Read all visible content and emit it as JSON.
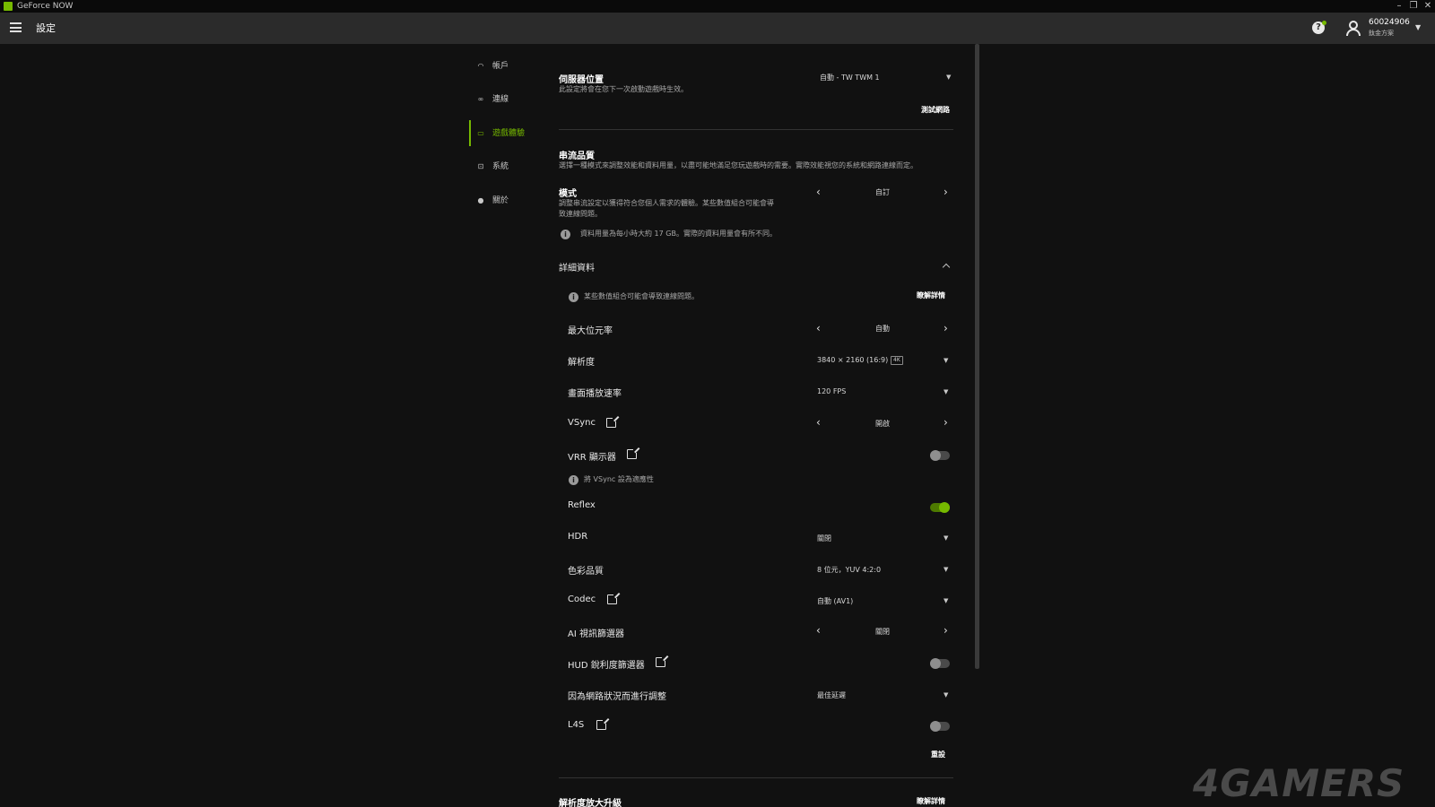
{
  "window": {
    "title": "GeForce NOW"
  },
  "header": {
    "title": "設定",
    "user_id": "60024906",
    "user_plan": "鈦金方案"
  },
  "sidebar": {
    "items": [
      {
        "label": "帳戶",
        "icon": "headset-icon"
      },
      {
        "label": "連線",
        "icon": "link-icon"
      },
      {
        "label": "遊戲體驗",
        "icon": "monitor-icon",
        "active": true
      },
      {
        "label": "系統",
        "icon": "system-icon"
      },
      {
        "label": "關於",
        "icon": "info-icon"
      }
    ]
  },
  "server": {
    "title": "伺服器位置",
    "desc": "此設定將會在您下一次啟動遊戲時生效。",
    "value": "自動 - TW TWM 1",
    "test_link": "測試網路"
  },
  "stream": {
    "title": "串流品質",
    "desc": "選擇一種模式來調整效能和資料用量，以盡可能地滿足您玩遊戲時的需要。實際效能視您的系統和網路連線而定。",
    "mode_label": "模式",
    "mode_desc_1": "調整串流設定以獲得符合您個人需求的體驗。某些數值組合可能會導",
    "mode_desc_2": "致連線問題。",
    "mode_value": "自訂",
    "data_note": "資料用量為每小時大約 17 GB。實際的資料用量會有所不同。"
  },
  "details": {
    "title": "詳細資料",
    "warning": "某些數值組合可能會導致連線問題。",
    "learn_more": "瞭解詳情",
    "max_bitrate": {
      "label": "最大位元率",
      "value": "自動"
    },
    "resolution": {
      "label": "解析度",
      "value": "3840 × 2160 (16:9)",
      "badge": "4K"
    },
    "framerate": {
      "label": "畫面播放速率",
      "value": "120 FPS"
    },
    "vsync": {
      "label": "VSync",
      "value": "開啟"
    },
    "vrr": {
      "label": "VRR 顯示器",
      "note": "將 VSync 設為適應性"
    },
    "reflex": {
      "label": "Reflex"
    },
    "hdr": {
      "label": "HDR",
      "value": "關閉"
    },
    "color": {
      "label": "色彩品質",
      "value": "8 位元，YUV 4:2:0"
    },
    "codec": {
      "label": "Codec",
      "value": "自動 (AV1)"
    },
    "ai_filter": {
      "label": "AI 視訊篩選器",
      "value": "關閉"
    },
    "hud": {
      "label": "HUD 銳利度篩選器"
    },
    "network_adjust": {
      "label": "因為網路狀況而進行調整",
      "value": "最佳延遲"
    },
    "l4s": {
      "label": "L4S"
    },
    "reset": "重設"
  },
  "upscale": {
    "title": "解析度放大升級",
    "learn_more": "瞭解詳情"
  },
  "toggles": {
    "vrr": false,
    "reflex": true,
    "hud": false,
    "l4s": false
  },
  "colors": {
    "accent": "#76b900",
    "background": "#111111",
    "header": "#2b2b2b"
  },
  "watermark": "4GAMERS"
}
